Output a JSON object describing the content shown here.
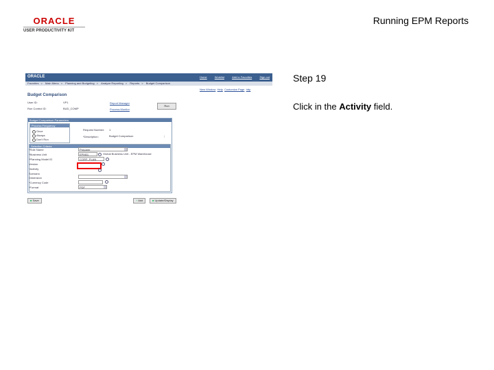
{
  "header": {
    "logo_brand": "ORACLE",
    "logo_kit": "USER PRODUCTIVITY KIT",
    "doc_title": "Running EPM Reports"
  },
  "step": {
    "label": "Step 19"
  },
  "instruction": {
    "prefix": "Click in the ",
    "target": "Activity",
    "suffix": " field."
  },
  "screenshot": {
    "ps_logo": "ORACLE",
    "top_links": [
      "Home",
      "Worklist",
      "Add to Favorites",
      "Sign out"
    ],
    "menu": [
      "Favorites",
      "Main Menu",
      "Planning and Budgeting",
      "Analyze Reporting",
      "Reports",
      "Budget Comparison"
    ],
    "toolbar": [
      "New Window",
      "Help",
      "Customize Page",
      "http"
    ],
    "page_title": "Budget Comparison",
    "user_id_label": "User ID:",
    "user_id_value": "VP1",
    "run_control_label": "Run Control ID:",
    "run_control_value": "BUD_COMP",
    "report_manager": "Report Manager",
    "process_monitor": "Process Monitor",
    "run_button": "Run",
    "section_title": "Budget Comparison Parameters",
    "freq_title": "Process Frequency",
    "freq_options": [
      "Once",
      "Always",
      "Don't Run"
    ],
    "request_label": "Request Number:",
    "request_value": "1",
    "desc_label": "*Description:",
    "desc_value": "Budget Comparison",
    "criteria_title": "Selection Criteria",
    "fields": [
      {
        "label": "*Role Name",
        "value": "Preparer"
      },
      {
        "label": "*Business Unit",
        "value": "EPM01"
      },
      {
        "label": "*Planning Model ID",
        "value": "CORP_PLAN"
      },
      {
        "label": "Version",
        "value": ""
      },
      {
        "label": "*Activity",
        "value": ""
      },
      {
        "label": "Scenario",
        "value": ""
      },
      {
        "label": "Dimension",
        "value": ""
      },
      {
        "label": "*Currency Code",
        "value": ""
      },
      {
        "label": "*Format",
        "value": "PDF"
      }
    ],
    "business_unit_desc": "Global Business Unit - EPM Warehouse",
    "save_button": "Save",
    "add_button": "Add",
    "update_button": "Update/Display"
  }
}
